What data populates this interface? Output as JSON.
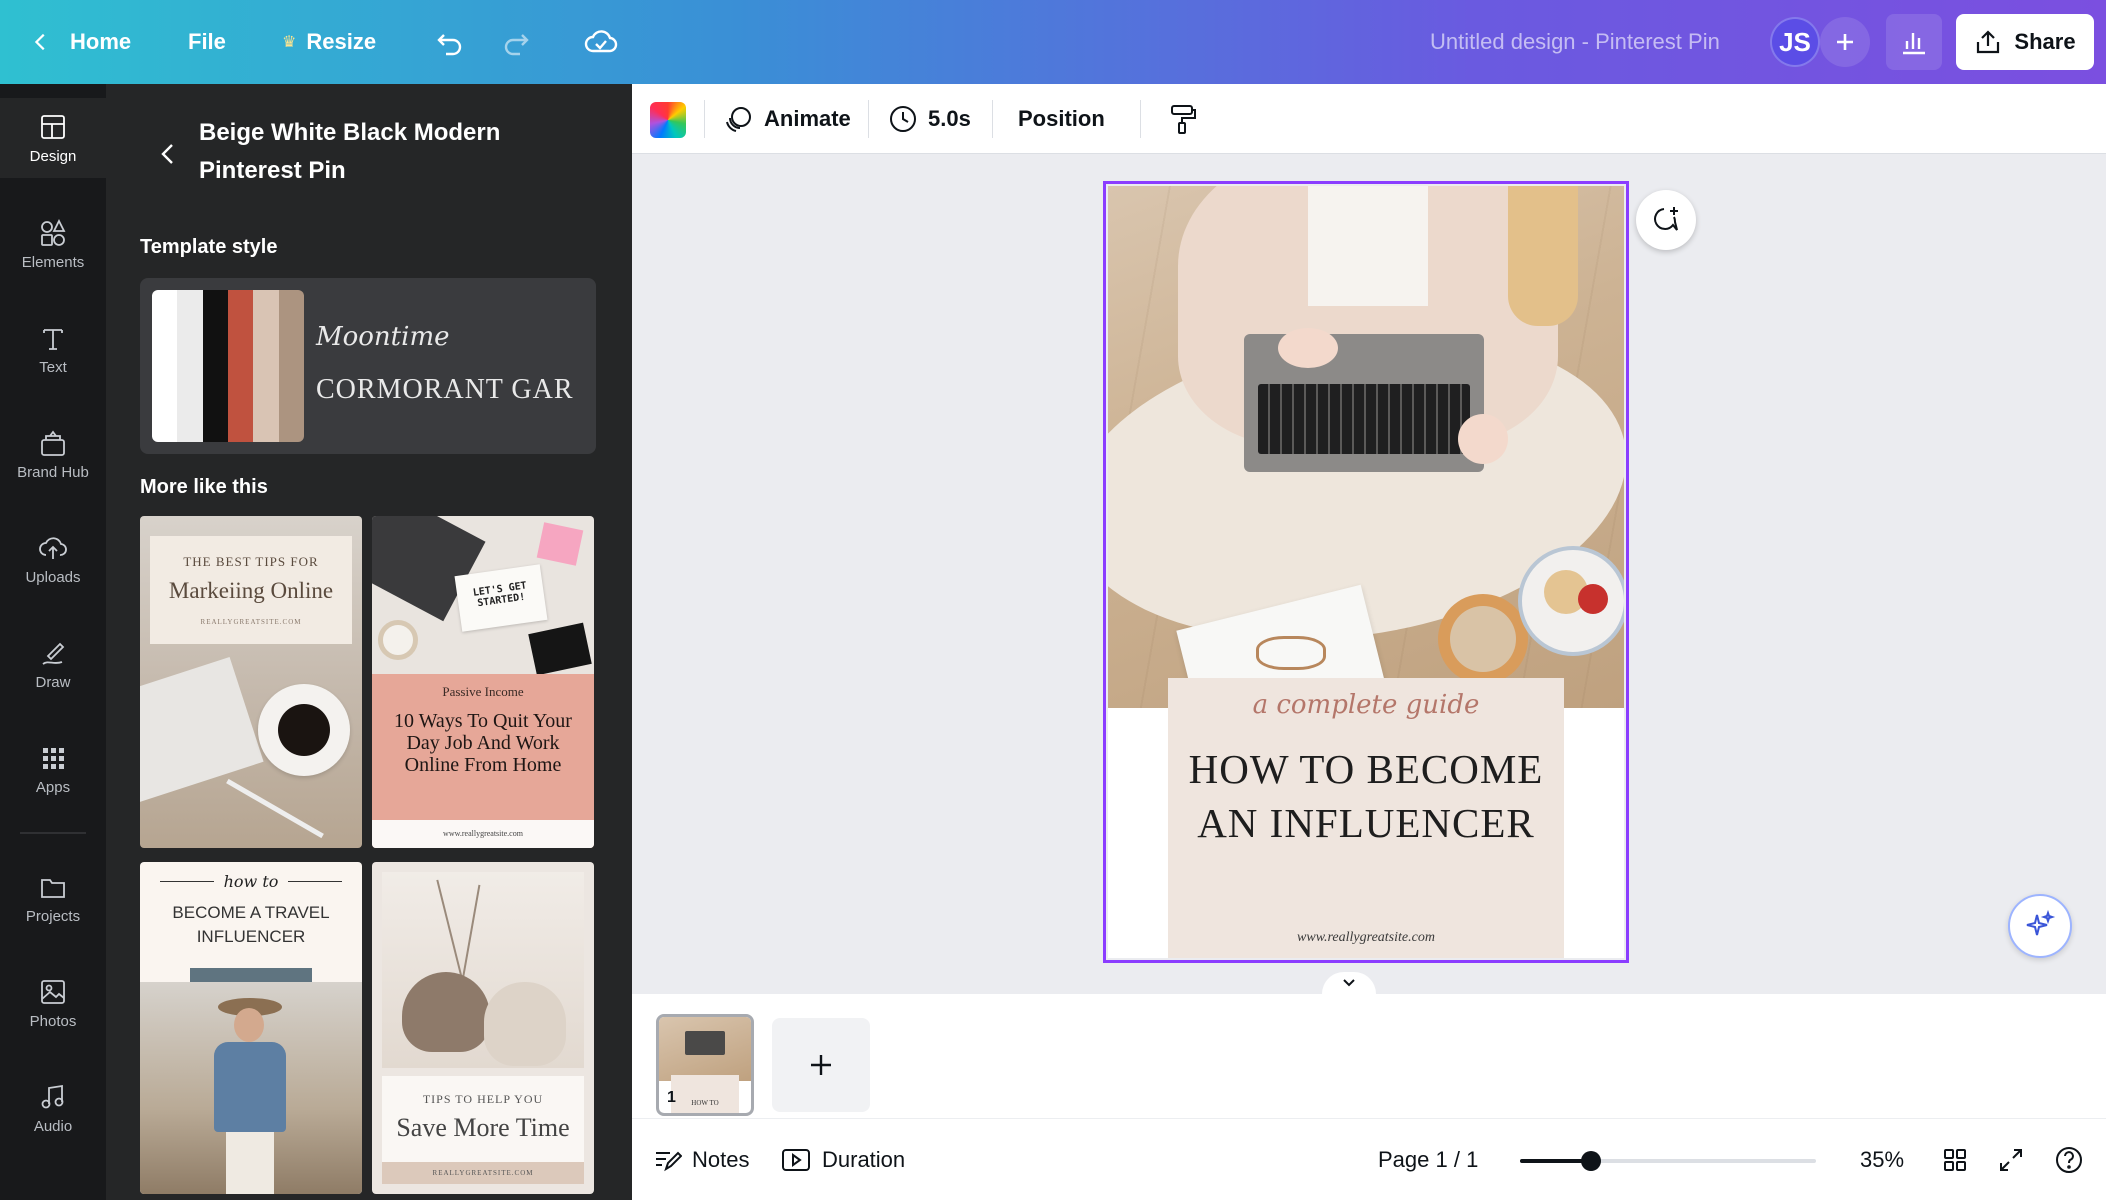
{
  "topbar": {
    "home_label": "Home",
    "file_label": "File",
    "resize_label": "Resize",
    "doc_title": "Untitled design - Pinterest Pin",
    "avatar_initials": "JS",
    "share_label": "Share"
  },
  "rail": {
    "items": [
      {
        "label": "Design",
        "icon": "design-icon"
      },
      {
        "label": "Elements",
        "icon": "elements-icon"
      },
      {
        "label": "Text",
        "icon": "text-icon"
      },
      {
        "label": "Brand Hub",
        "icon": "brand-hub-icon"
      },
      {
        "label": "Uploads",
        "icon": "upload-icon"
      },
      {
        "label": "Draw",
        "icon": "draw-icon"
      },
      {
        "label": "Apps",
        "icon": "apps-icon"
      },
      {
        "label": "Projects",
        "icon": "folder-icon"
      },
      {
        "label": "Photos",
        "icon": "photo-icon"
      },
      {
        "label": "Audio",
        "icon": "music-icon"
      }
    ]
  },
  "panel": {
    "title": "Beige White Black Modern Pinterest Pin",
    "template_style_label": "Template style",
    "swatches": [
      "#ffffff",
      "#ebebeb",
      "#111111",
      "#c0523f",
      "#d9c4b4",
      "#ac9480"
    ],
    "font_script": "Moontime",
    "font_serif": "CORMORANT GAR",
    "more_label": "More like this",
    "templates": [
      {
        "kicker": "THE BEST TIPS FOR",
        "title": "Markeiing Online",
        "footer": "REALLYGREATSITE.COM"
      },
      {
        "note": "LET'S GET STARTED!",
        "kicker": "Passive Income",
        "title": "10 Ways To Quit Your Day Job And Work Online From Home",
        "footer": "www.reallygreatsite.com"
      },
      {
        "kicker": "how to",
        "title": "BECOME A TRAVEL INFLUENCER"
      },
      {
        "kicker": "TIPS TO HELP YOU",
        "title": "Save More Time",
        "footer": "REALLYGREATSITE.COM"
      }
    ]
  },
  "toolbar": {
    "animate_label": "Animate",
    "duration_value": "5.0s",
    "position_label": "Position"
  },
  "canvas": {
    "tagline": "a complete guide",
    "headline": "HOW TO BECOME AN INFLUENCER",
    "website": "www.reallygreatsite.com"
  },
  "pages": {
    "thumb_number": "1",
    "thumb_text": "HOW TO"
  },
  "footer": {
    "notes_label": "Notes",
    "duration_label": "Duration",
    "page_indicator": "Page 1 / 1",
    "zoom_value": "35%",
    "zoom_fraction": 0.24
  }
}
